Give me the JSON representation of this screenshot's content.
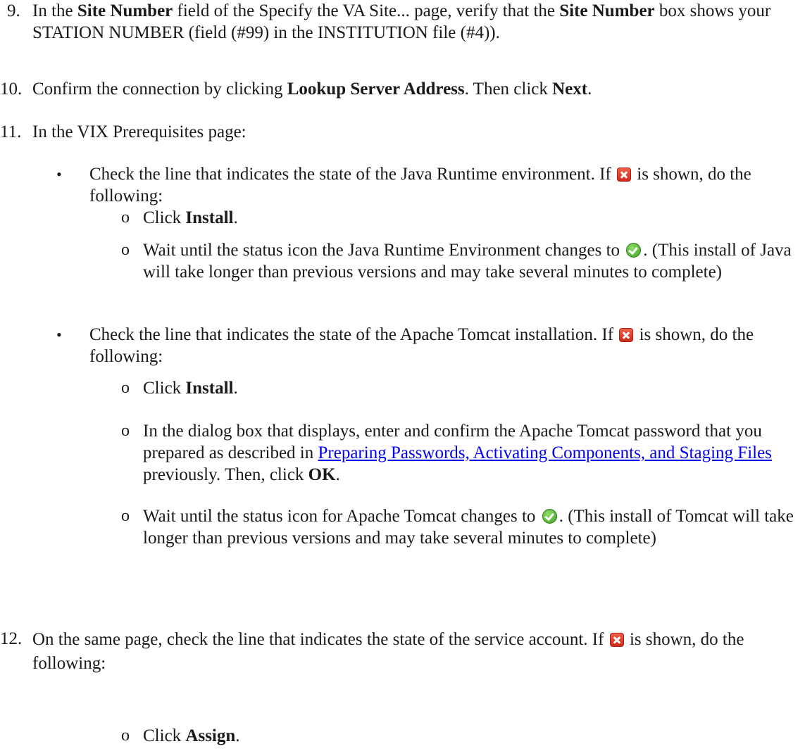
{
  "step9": {
    "number": "9.",
    "t1": "In the ",
    "b1": "Site Number",
    "t2": " field of the Specify the VA Site... page, verify that the ",
    "b2": "Site Number",
    "t3": " box shows your STATION NUMBER (field (#99) in the INSTITUTION file (#4))."
  },
  "step10": {
    "number": "10.",
    "t1": "Confirm the connection by clicking ",
    "b1": "Lookup Server Address",
    "t2": ". Then click ",
    "b2": "Next",
    "t3": "."
  },
  "step11": {
    "number": "11.",
    "text": "In the VIX Prerequisites page:",
    "java": {
      "t1": "Check the line that indicates the state of the Java Runtime environment. If ",
      "t2": " is shown, do the following:",
      "sub1": {
        "bullet": "o",
        "t1": "Click ",
        "b1": "Install",
        "t2": "."
      },
      "sub2": {
        "bullet": "o",
        "t1": "Wait until the status icon the Java Runtime Environment changes to ",
        "t2": ". (This install of Java will take longer than previous versions and may take several minutes to complete)"
      }
    },
    "tomcat": {
      "t1": "Check the line that indicates the state of the Apache Tomcat installation. If ",
      "t2": " is shown, do the following:",
      "sub1": {
        "bullet": "o",
        "t1": "Click ",
        "b1": "Install",
        "t2": "."
      },
      "sub2": {
        "bullet": "o",
        "t1": "In the dialog box that displays, enter and confirm the Apache Tomcat password that you prepared as described in ",
        "link": "Preparing Passwords, Activating Components, and Staging Files",
        "t2": " previously. Then, click ",
        "b1": "OK",
        "t3": "."
      },
      "sub3": {
        "bullet": "o",
        "t1": "Wait until the status icon for Apache Tomcat changes to ",
        "t2": ". (This install of Tomcat will take longer than previous versions and may take several minutes to complete)"
      }
    }
  },
  "step12": {
    "number": "12.",
    "t1": "On the same page, check the line that indicates the state of the service account. If ",
    "t2": " is shown, do the following:",
    "sub1": {
      "bullet": "o",
      "t1": "Click ",
      "b1": "Assign",
      "t2": "."
    }
  },
  "colors": {
    "link": "#0000ee",
    "error_icon": "#d0291b",
    "ok_icon": "#3f9f22"
  }
}
